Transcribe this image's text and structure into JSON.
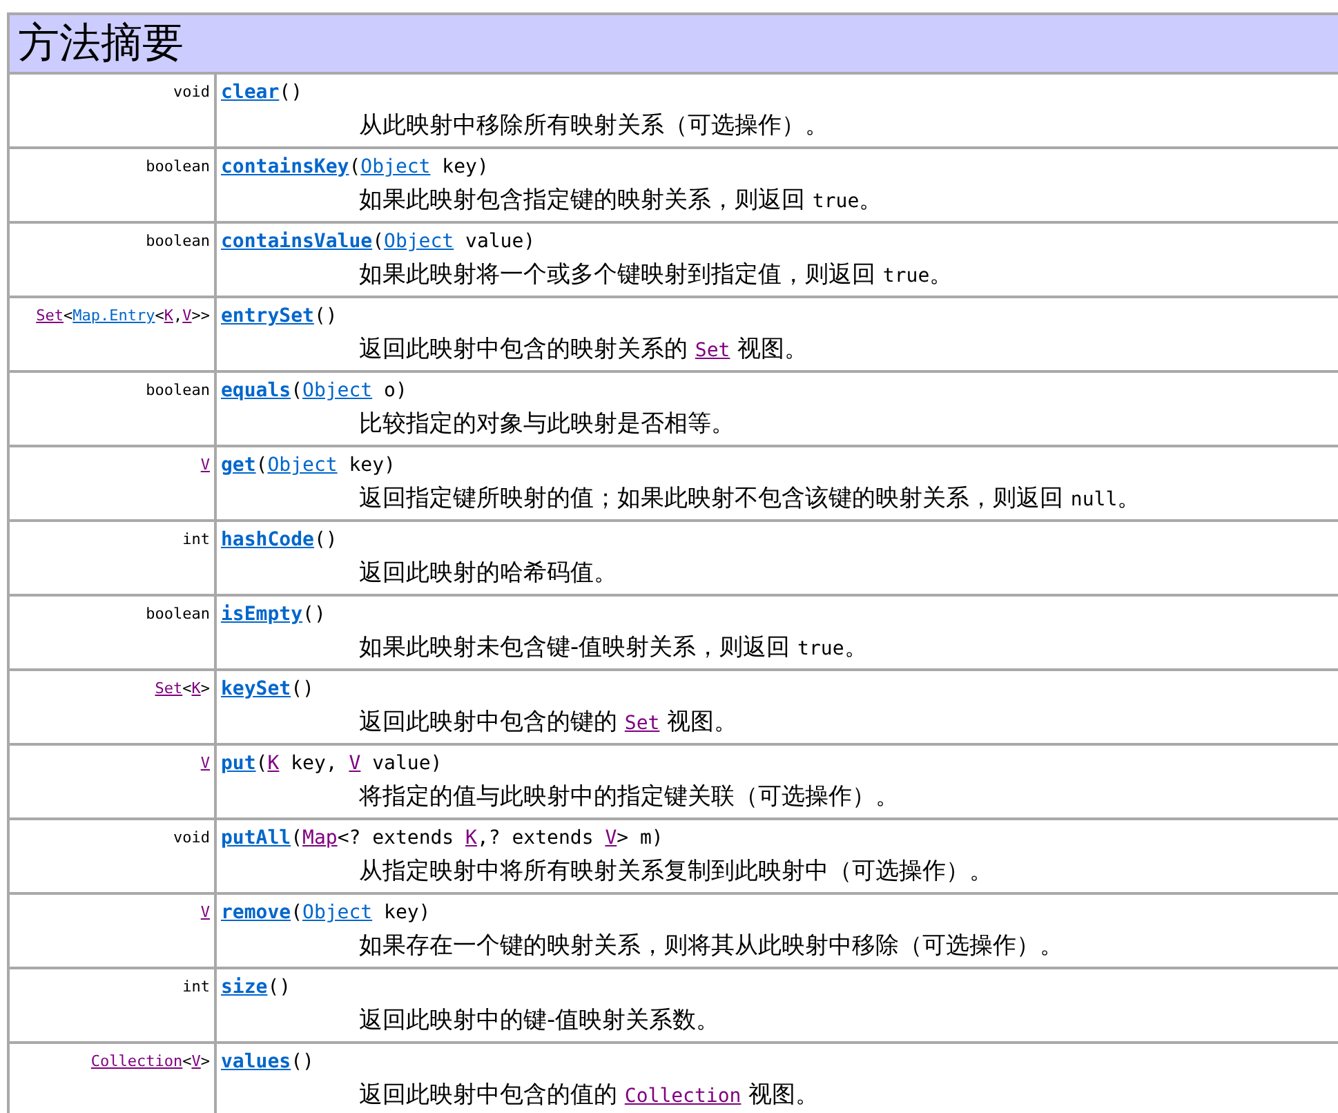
{
  "title": "方法摘要",
  "rows": [
    {
      "return_type": [
        {
          "text": "void",
          "kind": "plain"
        }
      ],
      "method": "clear",
      "params": [
        {
          "text": "()",
          "kind": "plain"
        }
      ],
      "description": [
        {
          "text": "从此映射中移除所有映射关系（可选操作）。",
          "kind": "plain"
        }
      ]
    },
    {
      "return_type": [
        {
          "text": "boolean",
          "kind": "plain"
        }
      ],
      "method": "containsKey",
      "params": [
        {
          "text": "(",
          "kind": "plain"
        },
        {
          "text": "Object",
          "kind": "link"
        },
        {
          "text": " key)",
          "kind": "plain"
        }
      ],
      "description": [
        {
          "text": "如果此映射包含指定键的映射关系，则返回 ",
          "kind": "plain"
        },
        {
          "text": "true",
          "kind": "code"
        },
        {
          "text": "。",
          "kind": "plain"
        }
      ]
    },
    {
      "return_type": [
        {
          "text": "boolean",
          "kind": "plain"
        }
      ],
      "method": "containsValue",
      "params": [
        {
          "text": "(",
          "kind": "plain"
        },
        {
          "text": "Object",
          "kind": "link"
        },
        {
          "text": " value)",
          "kind": "plain"
        }
      ],
      "description": [
        {
          "text": "如果此映射将一个或多个键映射到指定值，则返回 ",
          "kind": "plain"
        },
        {
          "text": "true",
          "kind": "code"
        },
        {
          "text": "。",
          "kind": "plain"
        }
      ]
    },
    {
      "return_type": [
        {
          "text": "Set",
          "kind": "visited"
        },
        {
          "text": "<",
          "kind": "plain"
        },
        {
          "text": "Map.Entry",
          "kind": "link"
        },
        {
          "text": "<",
          "kind": "plain"
        },
        {
          "text": "K",
          "kind": "visited"
        },
        {
          "text": ",",
          "kind": "plain"
        },
        {
          "text": "V",
          "kind": "visited"
        },
        {
          "text": ">>",
          "kind": "plain"
        }
      ],
      "method": "entrySet",
      "params": [
        {
          "text": "()",
          "kind": "plain"
        }
      ],
      "description": [
        {
          "text": "返回此映射中包含的映射关系的 ",
          "kind": "plain"
        },
        {
          "text": "Set",
          "kind": "visited"
        },
        {
          "text": " 视图。",
          "kind": "plain"
        }
      ]
    },
    {
      "return_type": [
        {
          "text": "boolean",
          "kind": "plain"
        }
      ],
      "method": "equals",
      "params": [
        {
          "text": "(",
          "kind": "plain"
        },
        {
          "text": "Object",
          "kind": "link"
        },
        {
          "text": " o)",
          "kind": "plain"
        }
      ],
      "description": [
        {
          "text": "比较指定的对象与此映射是否相等。",
          "kind": "plain"
        }
      ]
    },
    {
      "return_type": [
        {
          "text": "V",
          "kind": "visited"
        }
      ],
      "method": "get",
      "params": [
        {
          "text": "(",
          "kind": "plain"
        },
        {
          "text": "Object",
          "kind": "link"
        },
        {
          "text": " key)",
          "kind": "plain"
        }
      ],
      "description": [
        {
          "text": "返回指定键所映射的值；如果此映射不包含该键的映射关系，则返回 ",
          "kind": "plain"
        },
        {
          "text": "null",
          "kind": "code"
        },
        {
          "text": "。",
          "kind": "plain"
        }
      ]
    },
    {
      "return_type": [
        {
          "text": "int",
          "kind": "plain"
        }
      ],
      "method": "hashCode",
      "params": [
        {
          "text": "()",
          "kind": "plain"
        }
      ],
      "description": [
        {
          "text": "返回此映射的哈希码值。",
          "kind": "plain"
        }
      ]
    },
    {
      "return_type": [
        {
          "text": "boolean",
          "kind": "plain"
        }
      ],
      "method": "isEmpty",
      "params": [
        {
          "text": "()",
          "kind": "plain"
        }
      ],
      "description": [
        {
          "text": "如果此映射未包含键-值映射关系，则返回 ",
          "kind": "plain"
        },
        {
          "text": "true",
          "kind": "code"
        },
        {
          "text": "。",
          "kind": "plain"
        }
      ]
    },
    {
      "return_type": [
        {
          "text": "Set",
          "kind": "visited"
        },
        {
          "text": "<",
          "kind": "plain"
        },
        {
          "text": "K",
          "kind": "visited"
        },
        {
          "text": ">",
          "kind": "plain"
        }
      ],
      "method": "keySet",
      "params": [
        {
          "text": "()",
          "kind": "plain"
        }
      ],
      "description": [
        {
          "text": "返回此映射中包含的键的 ",
          "kind": "plain"
        },
        {
          "text": "Set",
          "kind": "visited"
        },
        {
          "text": " 视图。",
          "kind": "plain"
        }
      ]
    },
    {
      "return_type": [
        {
          "text": "V",
          "kind": "visited"
        }
      ],
      "method": "put",
      "params": [
        {
          "text": "(",
          "kind": "plain"
        },
        {
          "text": "K",
          "kind": "visited"
        },
        {
          "text": " key, ",
          "kind": "plain"
        },
        {
          "text": "V",
          "kind": "visited"
        },
        {
          "text": " value)",
          "kind": "plain"
        }
      ],
      "description": [
        {
          "text": "将指定的值与此映射中的指定键关联（可选操作）。",
          "kind": "plain"
        }
      ]
    },
    {
      "return_type": [
        {
          "text": "void",
          "kind": "plain"
        }
      ],
      "method": "putAll",
      "params": [
        {
          "text": "(",
          "kind": "plain"
        },
        {
          "text": "Map",
          "kind": "visited"
        },
        {
          "text": "<? extends ",
          "kind": "plain"
        },
        {
          "text": "K",
          "kind": "visited"
        },
        {
          "text": ",? extends ",
          "kind": "plain"
        },
        {
          "text": "V",
          "kind": "visited"
        },
        {
          "text": "> m)",
          "kind": "plain"
        }
      ],
      "description": [
        {
          "text": "从指定映射中将所有映射关系复制到此映射中（可选操作）。",
          "kind": "plain"
        }
      ]
    },
    {
      "return_type": [
        {
          "text": "V",
          "kind": "visited"
        }
      ],
      "method": "remove",
      "params": [
        {
          "text": "(",
          "kind": "plain"
        },
        {
          "text": "Object",
          "kind": "link"
        },
        {
          "text": " key)",
          "kind": "plain"
        }
      ],
      "description": [
        {
          "text": "如果存在一个键的映射关系，则将其从此映射中移除（可选操作）。",
          "kind": "plain"
        }
      ]
    },
    {
      "return_type": [
        {
          "text": "int",
          "kind": "plain"
        }
      ],
      "method": "size",
      "params": [
        {
          "text": "()",
          "kind": "plain"
        }
      ],
      "description": [
        {
          "text": "返回此映射中的键-值映射关系数。",
          "kind": "plain"
        }
      ]
    },
    {
      "return_type": [
        {
          "text": "Collection",
          "kind": "visited"
        },
        {
          "text": "<",
          "kind": "plain"
        },
        {
          "text": "V",
          "kind": "visited"
        },
        {
          "text": ">",
          "kind": "plain"
        }
      ],
      "method": "values",
      "params": [
        {
          "text": "()",
          "kind": "plain"
        }
      ],
      "description": [
        {
          "text": "返回此映射中包含的值的 ",
          "kind": "plain"
        },
        {
          "text": "Collection",
          "kind": "visited"
        },
        {
          "text": " 视图。",
          "kind": "plain"
        }
      ]
    }
  ]
}
